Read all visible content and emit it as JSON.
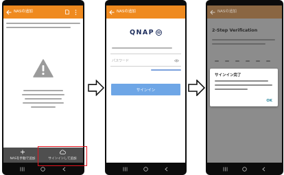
{
  "screens": [
    {
      "header": {
        "title": "NASの追加",
        "back_icon": "back-arrow-icon",
        "actions": [
          "document-icon",
          "more-vert-icon"
        ]
      },
      "empty_state_icon": "warning-icon",
      "bottom_bar": {
        "add_manually": {
          "icon": "plus-icon",
          "label": "NASを手動で追加"
        },
        "sign_in_add": {
          "icon": "cloud-icon",
          "label": "サインインして追加"
        }
      },
      "nav": [
        "recents-icon",
        "home-icon",
        "back-icon"
      ]
    },
    {
      "header": {
        "title": "NASの追加",
        "back_icon": "back-arrow-icon"
      },
      "logo": {
        "brand": "QNAP",
        "suffix": "ID"
      },
      "password_placeholder": "パスワード",
      "password_toggle_icon": "eye-icon",
      "sign_in_button": "サインイン",
      "nav": [
        "recents-icon",
        "home-icon",
        "back-icon"
      ]
    },
    {
      "header": {
        "title": "NASの追加",
        "back_icon": "back-arrow-icon"
      },
      "title": "2-Step Verification",
      "dialog": {
        "title": "サインイン完了",
        "ok_button": "OK"
      },
      "nav": [
        "recents-icon",
        "home-icon",
        "back-icon"
      ]
    }
  ],
  "flow_arrows": [
    "right-arrow-icon",
    "right-arrow-icon"
  ],
  "colors": {
    "header": "#ef8a1f",
    "sign_in_button": "#6ea6e6",
    "highlight_box": "#e3141e",
    "link": "#7aa0dd",
    "dialog_ok": "#2f8aa0"
  }
}
